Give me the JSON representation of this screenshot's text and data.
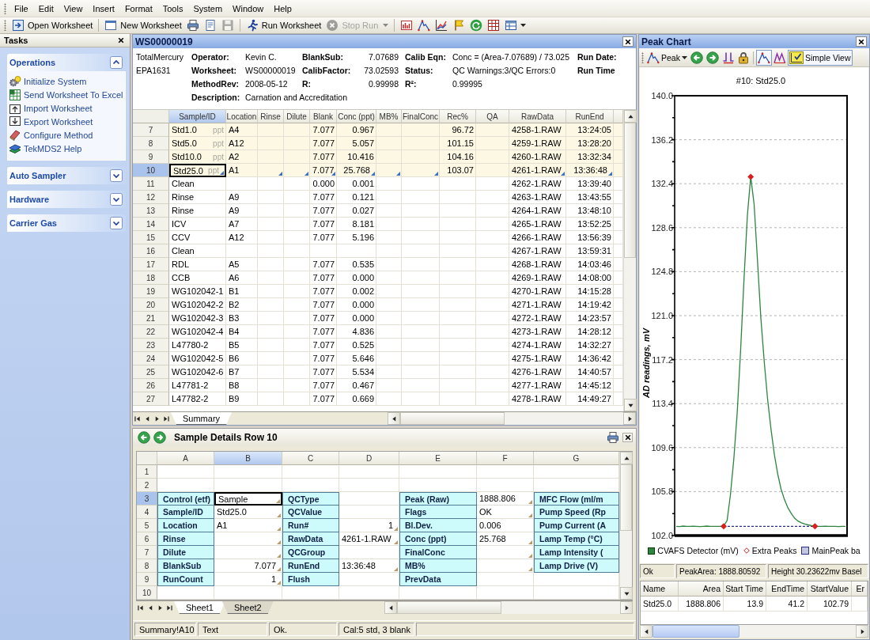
{
  "menu_bar": {
    "items": [
      "File",
      "Edit",
      "View",
      "Insert",
      "Format",
      "Tools",
      "System",
      "Window",
      "Help"
    ]
  },
  "toolbar": {
    "items": [
      {
        "kind": "button",
        "label": "Open Worksheet",
        "disabled": false
      },
      {
        "kind": "separator"
      },
      {
        "kind": "button",
        "label": "New Worksheet",
        "disabled": false
      },
      {
        "kind": "icon",
        "disabled": false
      },
      {
        "kind": "icon",
        "disabled": false
      },
      {
        "kind": "icon",
        "disabled": true
      },
      {
        "kind": "separator"
      },
      {
        "kind": "button",
        "label": "Run Worksheet",
        "disabled": false
      },
      {
        "kind": "button",
        "label": "Stop Run",
        "disabled": true
      },
      {
        "kind": "dropdown",
        "disabled": true
      },
      {
        "kind": "separator"
      },
      {
        "kind": "icon",
        "disabled": false
      },
      {
        "kind": "icon",
        "disabled": false
      },
      {
        "kind": "icon",
        "disabled": false
      },
      {
        "kind": "icon",
        "disabled": false
      },
      {
        "kind": "icon",
        "disabled": false
      },
      {
        "kind": "icon",
        "disabled": false
      },
      {
        "kind": "icon-dropdown",
        "disabled": false
      }
    ]
  },
  "tasks_panel": {
    "title": "Tasks",
    "groups": [
      {
        "title": "Operations",
        "expanded": true,
        "items": [
          "Initialize System",
          "Send Worksheet To Excel",
          "Import Worksheet",
          "Export Worksheet",
          "Configure Method",
          "TekMDS2 Help"
        ]
      },
      {
        "title": "Auto Sampler",
        "expanded": false
      },
      {
        "title": "Hardware",
        "expanded": false
      },
      {
        "title": "Carrier Gas",
        "expanded": false
      }
    ]
  },
  "worksheet": {
    "title": "WS00000019",
    "method": [
      "TotalMercury",
      "EPA1631"
    ],
    "info_groups": [
      [
        {
          "label": "Operator:",
          "value": "Kevin C."
        },
        {
          "label": "Worksheet:",
          "value": "WS00000019"
        },
        {
          "label": "MethodRev:",
          "value": "2008-05-12"
        },
        {
          "label": "Description:",
          "value": "Carnation and Accreditation"
        }
      ],
      [
        {
          "label": "BlankSub:",
          "value": "7.07689"
        },
        {
          "label": "CalibFactor:",
          "value": "73.02593"
        },
        {
          "label": "R:",
          "value": "0.99998"
        }
      ],
      [
        {
          "label": "Calib Eqn:",
          "value": "Conc = (Area-7.07689) / 73.025"
        },
        {
          "label": "Status:",
          "value": "QC Warnings:3/QC Errors:0"
        },
        {
          "label": "R²:",
          "value": "0.99995"
        }
      ],
      [
        {
          "label": "Run Date:"
        },
        {
          "label": "Run Time"
        }
      ]
    ],
    "table": {
      "columns": [
        {
          "label": "Sample/ID",
          "kind": "text",
          "selected": true
        },
        {
          "label": "Location",
          "kind": "text",
          "selected": false
        },
        {
          "label": "Rinse",
          "kind": "text",
          "selected": false
        },
        {
          "label": "Dilute",
          "kind": "text",
          "selected": false
        },
        {
          "label": "Blank",
          "kind": "number",
          "selected": false
        },
        {
          "label": "Conc (ppt)",
          "kind": "number",
          "selected": false
        },
        {
          "label": "MB%",
          "kind": "number",
          "selected": false
        },
        {
          "label": "FinalConc",
          "kind": "number",
          "selected": false
        },
        {
          "label": "Rec%",
          "kind": "number",
          "selected": false
        },
        {
          "label": "QA",
          "kind": "text",
          "selected": false
        },
        {
          "label": "RawData",
          "kind": "text",
          "selected": false
        },
        {
          "label": "RunEnd",
          "kind": "number",
          "selected": false
        }
      ],
      "rows": [
        {
          "row": "7",
          "kind": "standard",
          "selected": false,
          "unit": "ppt",
          "cells": [
            "Std1.0",
            "A4",
            null,
            null,
            "7.077",
            "0.967",
            null,
            null,
            "96.72",
            null,
            "4258-1.RAW",
            "13:24:05"
          ]
        },
        {
          "row": "8",
          "kind": "standard",
          "selected": false,
          "unit": "ppt",
          "cells": [
            "Std5.0",
            "A12",
            null,
            null,
            "7.077",
            "5.057",
            null,
            null,
            "101.15",
            null,
            "4259-1.RAW",
            "13:28:20"
          ]
        },
        {
          "row": "9",
          "kind": "standard",
          "selected": false,
          "unit": "ppt",
          "cells": [
            "Std10.0",
            "A2",
            null,
            null,
            "7.077",
            "10.416",
            null,
            null,
            "104.16",
            null,
            "4260-1.RAW",
            "13:32:34"
          ]
        },
        {
          "row": "10",
          "kind": "standard",
          "selected": true,
          "unit": "ppt",
          "cells": [
            "Std25.0",
            "A1",
            null,
            null,
            "7.077",
            "25.768",
            null,
            null,
            "103.07",
            null,
            "4261-1.RAW",
            "13:36:48"
          ],
          "corner_marks": [
            true,
            false,
            true,
            true,
            true,
            true,
            true,
            true,
            false,
            false,
            true,
            true
          ]
        },
        {
          "row": "11",
          "kind": "sample",
          "selected": false,
          "cells": [
            "Clean",
            null,
            null,
            null,
            "0.000",
            "0.001",
            null,
            null,
            null,
            null,
            "4262-1.RAW",
            "13:39:40"
          ]
        },
        {
          "row": "12",
          "kind": "sample",
          "selected": false,
          "cells": [
            "Rinse",
            "A9",
            null,
            null,
            "7.077",
            "0.121",
            null,
            null,
            null,
            null,
            "4263-1.RAW",
            "13:43:55"
          ]
        },
        {
          "row": "13",
          "kind": "sample",
          "selected": false,
          "cells": [
            "Rinse",
            "A9",
            null,
            null,
            "7.077",
            "0.027",
            null,
            null,
            null,
            null,
            "4264-1.RAW",
            "13:48:10"
          ]
        },
        {
          "row": "14",
          "kind": "sample",
          "selected": false,
          "cells": [
            "ICV",
            "A7",
            null,
            null,
            "7.077",
            "8.181",
            null,
            null,
            null,
            null,
            "4265-1.RAW",
            "13:52:25"
          ]
        },
        {
          "row": "15",
          "kind": "sample",
          "selected": false,
          "cells": [
            "CCV",
            "A12",
            null,
            null,
            "7.077",
            "5.196",
            null,
            null,
            null,
            null,
            "4266-1.RAW",
            "13:56:39"
          ]
        },
        {
          "row": "16",
          "kind": "sample",
          "selected": false,
          "cells": [
            "Clean",
            null,
            null,
            null,
            null,
            null,
            null,
            null,
            null,
            null,
            "4267-1.RAW",
            "13:59:31"
          ]
        },
        {
          "row": "17",
          "kind": "sample",
          "selected": false,
          "cells": [
            "RDL",
            "A5",
            null,
            null,
            "7.077",
            "0.535",
            null,
            null,
            null,
            null,
            "4268-1.RAW",
            "14:03:46"
          ]
        },
        {
          "row": "18",
          "kind": "sample",
          "selected": false,
          "cells": [
            "CCB",
            "A6",
            null,
            null,
            "7.077",
            "0.000",
            null,
            null,
            null,
            null,
            "4269-1.RAW",
            "14:08:00"
          ]
        },
        {
          "row": "19",
          "kind": "sample",
          "selected": false,
          "cells": [
            "WG102042-1",
            "B1",
            null,
            null,
            "7.077",
            "0.002",
            null,
            null,
            null,
            null,
            "4270-1.RAW",
            "14:15:28"
          ]
        },
        {
          "row": "20",
          "kind": "sample",
          "selected": false,
          "cells": [
            "WG102042-2",
            "B2",
            null,
            null,
            "7.077",
            "0.000",
            null,
            null,
            null,
            null,
            "4271-1.RAW",
            "14:19:42"
          ]
        },
        {
          "row": "21",
          "kind": "sample",
          "selected": false,
          "cells": [
            "WG102042-3",
            "B3",
            null,
            null,
            "7.077",
            "0.000",
            null,
            null,
            null,
            null,
            "4272-1.RAW",
            "14:23:57"
          ]
        },
        {
          "row": "22",
          "kind": "sample",
          "selected": false,
          "cells": [
            "WG102042-4",
            "B4",
            null,
            null,
            "7.077",
            "4.836",
            null,
            null,
            null,
            null,
            "4273-1.RAW",
            "14:28:12"
          ]
        },
        {
          "row": "23",
          "kind": "sample",
          "selected": false,
          "cells": [
            "L47780-2",
            "B5",
            null,
            null,
            "7.077",
            "0.525",
            null,
            null,
            null,
            null,
            "4274-1.RAW",
            "14:32:27"
          ]
        },
        {
          "row": "24",
          "kind": "sample",
          "selected": false,
          "cells": [
            "WG102042-5",
            "B6",
            null,
            null,
            "7.077",
            "5.646",
            null,
            null,
            null,
            null,
            "4275-1.RAW",
            "14:36:42"
          ]
        },
        {
          "row": "25",
          "kind": "sample",
          "selected": false,
          "cells": [
            "WG102042-6",
            "B7",
            null,
            null,
            "7.077",
            "5.534",
            null,
            null,
            null,
            null,
            "4276-1.RAW",
            "14:40:57"
          ]
        },
        {
          "row": "26",
          "kind": "sample",
          "selected": false,
          "cells": [
            "L47781-2",
            "B8",
            null,
            null,
            "7.077",
            "0.467",
            null,
            null,
            null,
            null,
            "4277-1.RAW",
            "14:45:12"
          ]
        },
        {
          "row": "27",
          "kind": "sample",
          "selected": false,
          "cells": [
            "L47782-2",
            "B9",
            null,
            null,
            "7.077",
            "0.669",
            null,
            null,
            null,
            null,
            "4278-1.RAW",
            "14:49:27"
          ]
        }
      ]
    },
    "sheet_tabs": [
      {
        "label": "Summary",
        "selected": true
      }
    ]
  },
  "sample_details": {
    "title": "Sample Details Row 10",
    "columns": [
      {
        "label": "A",
        "selected": false
      },
      {
        "label": "B",
        "selected": true
      },
      {
        "label": "C",
        "selected": false
      },
      {
        "label": "D",
        "selected": false
      },
      {
        "label": "E",
        "selected": false
      },
      {
        "label": "F",
        "selected": false
      },
      {
        "label": "G",
        "selected": false
      }
    ],
    "rows": [
      {
        "row": "1",
        "selected": false,
        "cells": [
          null,
          null,
          null,
          null,
          null,
          null,
          null
        ]
      },
      {
        "row": "2",
        "selected": false,
        "cells": [
          null,
          null,
          null,
          null,
          null,
          null,
          null
        ]
      },
      {
        "row": "3",
        "selected": true,
        "cells": [
          {
            "kind": "label",
            "text": "Control (etf)"
          },
          {
            "kind": "text",
            "text": "Sample",
            "corner_mark": true
          },
          {
            "kind": "label",
            "text": "QCType"
          },
          null,
          {
            "kind": "label",
            "text": "Peak (Raw)"
          },
          {
            "kind": "text",
            "text": "1888.806",
            "corner_mark": true
          },
          {
            "kind": "label",
            "text": "MFC Flow (ml/m"
          }
        ]
      },
      {
        "row": "4",
        "selected": false,
        "cells": [
          {
            "kind": "label",
            "text": "Sample/ID"
          },
          {
            "kind": "text",
            "text": "Std25.0",
            "corner_mark": true
          },
          {
            "kind": "label",
            "text": "QCValue"
          },
          null,
          {
            "kind": "label",
            "text": "Flags"
          },
          {
            "kind": "text",
            "text": "OK",
            "corner_mark": true
          },
          {
            "kind": "label",
            "text": "Pump Speed (Rp"
          }
        ]
      },
      {
        "row": "5",
        "selected": false,
        "cells": [
          {
            "kind": "label",
            "text": "Location"
          },
          {
            "kind": "text",
            "text": "A1",
            "corner_mark": true
          },
          {
            "kind": "label",
            "text": "Run#"
          },
          {
            "kind": "number",
            "text": "1",
            "corner_mark": true
          },
          {
            "kind": "label",
            "text": "Bl.Dev."
          },
          {
            "kind": "text",
            "text": "0.006",
            "corner_mark": false
          },
          {
            "kind": "label",
            "text": "Pump Current (A"
          }
        ]
      },
      {
        "row": "6",
        "selected": false,
        "cells": [
          {
            "kind": "label",
            "text": "Rinse"
          },
          {
            "kind": "text",
            "corner_mark": true
          },
          {
            "kind": "label",
            "text": "RawData"
          },
          {
            "kind": "text",
            "text": "4261-1.RAW",
            "corner_mark": true
          },
          {
            "kind": "label",
            "text": "Conc (ppt)"
          },
          {
            "kind": "text",
            "text": "25.768",
            "corner_mark": true
          },
          {
            "kind": "label",
            "text": "Lamp Temp (°C)"
          }
        ]
      },
      {
        "row": "7",
        "selected": false,
        "cells": [
          {
            "kind": "label",
            "text": "Dilute"
          },
          {
            "kind": "text",
            "corner_mark": true
          },
          {
            "kind": "label",
            "text": "QCGroup"
          },
          null,
          {
            "kind": "label",
            "text": "FinalConc"
          },
          {
            "kind": "text",
            "corner_mark": true
          },
          {
            "kind": "label",
            "text": "Lamp Intensity ("
          }
        ]
      },
      {
        "row": "8",
        "selected": false,
        "cells": [
          {
            "kind": "label",
            "text": "BlankSub"
          },
          {
            "kind": "number",
            "text": "7.077",
            "corner_mark": true
          },
          {
            "kind": "label",
            "text": "RunEnd"
          },
          {
            "kind": "text",
            "text": "13:36:48",
            "corner_mark": true
          },
          {
            "kind": "label",
            "text": "MB%"
          },
          {
            "kind": "text",
            "corner_mark": true
          },
          {
            "kind": "label",
            "text": "Lamp Drive (V)"
          }
        ]
      },
      {
        "row": "9",
        "selected": false,
        "cells": [
          {
            "kind": "label",
            "text": "RunCount"
          },
          {
            "kind": "number",
            "text": "1",
            "corner_mark": true
          },
          {
            "kind": "label",
            "text": "Flush"
          },
          null,
          {
            "kind": "label",
            "text": "PrevData"
          },
          null,
          null
        ]
      },
      {
        "row": "10",
        "selected": false,
        "cells": [
          null,
          null,
          null,
          null,
          null,
          null,
          null
        ]
      }
    ],
    "sheet_tabs": [
      {
        "label": "Sheet1",
        "selected": true
      },
      {
        "label": "Sheet2",
        "selected": false
      }
    ]
  },
  "status_bar": [
    "Summary!A10",
    "Text",
    "Ok.",
    "Cal:5 std, 3 blank"
  ],
  "peak_chart": {
    "title": "Peak Chart",
    "toolbar": [
      {
        "kind": "menu",
        "label": "Peak"
      },
      {
        "kind": "icon"
      },
      {
        "kind": "icon"
      },
      {
        "kind": "icon"
      },
      {
        "kind": "icon"
      },
      {
        "kind": "separator"
      },
      {
        "kind": "toggle",
        "selected": true
      },
      {
        "kind": "toggle",
        "selected": false
      },
      {
        "kind": "toggle",
        "label": "Simple View",
        "selected": true
      }
    ],
    "chart_data": {
      "type": "line",
      "title": "#10: Std25.0",
      "ylabel": "AD readings, mV",
      "categories": [
        null,
        null,
        null,
        null,
        null,
        null,
        null,
        null,
        null,
        null,
        null,
        null,
        null,
        null,
        null,
        null,
        null,
        null,
        null,
        null,
        null,
        null,
        null,
        null,
        null,
        null,
        null,
        null,
        null,
        null,
        null,
        null,
        null,
        null,
        null,
        null,
        null,
        null,
        null,
        null,
        null,
        null,
        null,
        null,
        null,
        null,
        null,
        null,
        null,
        null,
        null
      ],
      "ylim": [
        102,
        140
      ],
      "yticks": [
        {
          "value": 102,
          "label": "102.0"
        },
        105.8,
        109.6,
        113.4,
        117.2,
        {
          "value": 121,
          "label": "121.0"
        },
        124.8,
        128.6,
        132.4,
        136.2,
        {
          "value": 140,
          "label": "140.0"
        }
      ],
      "grid": true,
      "legend": "bottom",
      "series": [
        {
          "name": "CVAFS Detector (mV)",
          "color": "#2e8540",
          "line_style": "solid",
          "values": [
            102.8,
            102.78,
            102.82,
            102.8,
            102.79,
            102.81,
            102.8,
            102.78,
            102.8,
            102.82,
            102.8,
            102.79,
            102.8,
            102.8,
            102.82,
            103.3,
            105.5,
            108.6,
            112.6,
            118.0,
            124.0,
            129.6,
            133.0,
            130.6,
            125.8,
            120.8,
            117.0,
            113.8,
            111.2,
            109.0,
            107.3,
            106.0,
            105.1,
            104.4,
            103.9,
            103.5,
            103.25,
            103.1,
            103.0,
            102.92,
            102.86,
            102.82,
            102.8,
            102.8,
            102.81,
            102.79,
            102.8,
            102.8,
            102.78,
            102.8,
            102.79
          ]
        },
        {
          "name": "Extra Peaks",
          "color": "#d81e1e",
          "type": "scatter",
          "marker": "diamond",
          "values": [
            null,
            null,
            null,
            null,
            null,
            null,
            null,
            null,
            null,
            null,
            null,
            null,
            null,
            null,
            102.8,
            null,
            null,
            null,
            null,
            null,
            null,
            null,
            133.0,
            null,
            null,
            null,
            null,
            null,
            null,
            null,
            null,
            null,
            null,
            null,
            null,
            null,
            null,
            null,
            null,
            null,
            null,
            102.8,
            null,
            null,
            null,
            null,
            null,
            null,
            null,
            null,
            null
          ]
        },
        {
          "name": "MainPeak ba",
          "color": "#2b2f8f",
          "line_style": "dashed",
          "values": [
            null,
            null,
            null,
            null,
            null,
            null,
            null,
            null,
            null,
            null,
            null,
            null,
            null,
            null,
            102.8,
            102.8,
            102.8,
            102.8,
            102.8,
            102.8,
            102.8,
            102.8,
            102.8,
            102.8,
            102.8,
            102.8,
            102.8,
            102.8,
            102.8,
            102.8,
            102.8,
            102.8,
            102.8,
            102.8,
            102.8,
            102.8,
            102.8,
            102.8,
            102.8,
            102.8,
            102.8,
            102.8,
            null,
            null,
            null,
            null,
            null,
            null,
            null,
            null,
            null
          ]
        }
      ]
    },
    "status": [
      "Ok",
      "PeakArea: 1888.80592",
      "Height 30.23622mv Basel"
    ],
    "results": {
      "columns": [
        "Name",
        "Area",
        "Start Time",
        "EndTime",
        "StartValue",
        "Er"
      ],
      "rows": [
        {
          "cells": [
            "Std25.0",
            "1888.806",
            "13.9",
            "41.2",
            "102.79",
            null
          ]
        }
      ]
    }
  }
}
